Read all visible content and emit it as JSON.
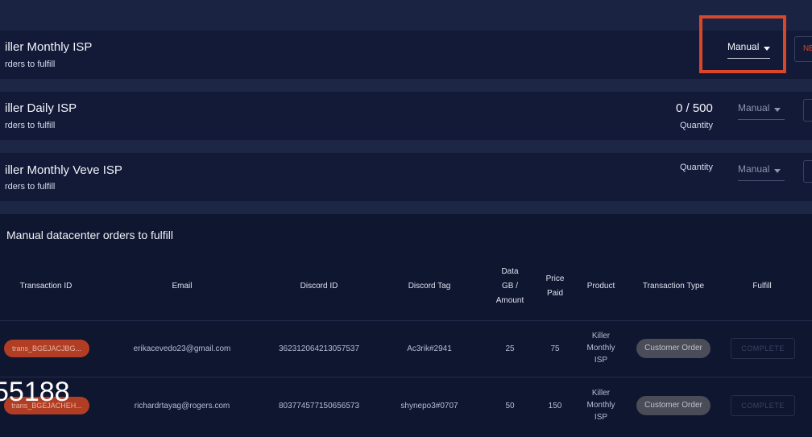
{
  "products": [
    {
      "title": "iller Monthly ISP",
      "subtitle": "rders to fulfill",
      "mode": "Manual",
      "side_button": "NE"
    },
    {
      "title": "iller Daily ISP",
      "subtitle": "rders to fulfill",
      "quantity_value": "0 / 500",
      "quantity_label": "Quantity",
      "mode": "Manual"
    },
    {
      "title": "iller Monthly Veve ISP",
      "subtitle": "rders to fulfill",
      "quantity_label": "Quantity",
      "mode": "Manual"
    }
  ],
  "manual_dc": {
    "title": "Manual datacenter orders to fulfill",
    "headers": {
      "transaction_id": "Transaction ID",
      "email": "Email",
      "discord_id": "Discord ID",
      "discord_tag": "Discord Tag",
      "data_gb_amount": [
        "Data",
        "GB /",
        "Amount"
      ],
      "price_paid": [
        "Price",
        "Paid"
      ],
      "product": "Product",
      "transaction_type": "Transaction Type",
      "fulfill": "Fulfill"
    },
    "rows": [
      {
        "transaction_id": "trans_BGEJACJBG...",
        "email": "erikacevedo23@gmail.com",
        "discord_id": "362312064213057537",
        "discord_tag": "Ac3rik#2941",
        "data_gb": "25",
        "price_paid": "75",
        "product": [
          "Killer",
          "Monthly",
          "ISP"
        ],
        "transaction_type": "Customer Order",
        "fulfill": "COMPLETE"
      },
      {
        "transaction_id": "trans_BGEJACHEH...",
        "email": "richardrtayag@rogers.com",
        "discord_id": "803774577150656573",
        "discord_tag": "shynepo3#0707",
        "data_gb": "50",
        "price_paid": "150",
        "product": [
          "Killer",
          "Monthly",
          "ISP"
        ],
        "transaction_type": "Customer Order",
        "fulfill": "COMPLETE"
      }
    ]
  },
  "overlay_text": "55188",
  "colors": {
    "highlight": "#d9472b",
    "background": "#0f1630",
    "card": "#121a37"
  },
  "icons": {
    "select_caret": "chevron-down-icon"
  }
}
